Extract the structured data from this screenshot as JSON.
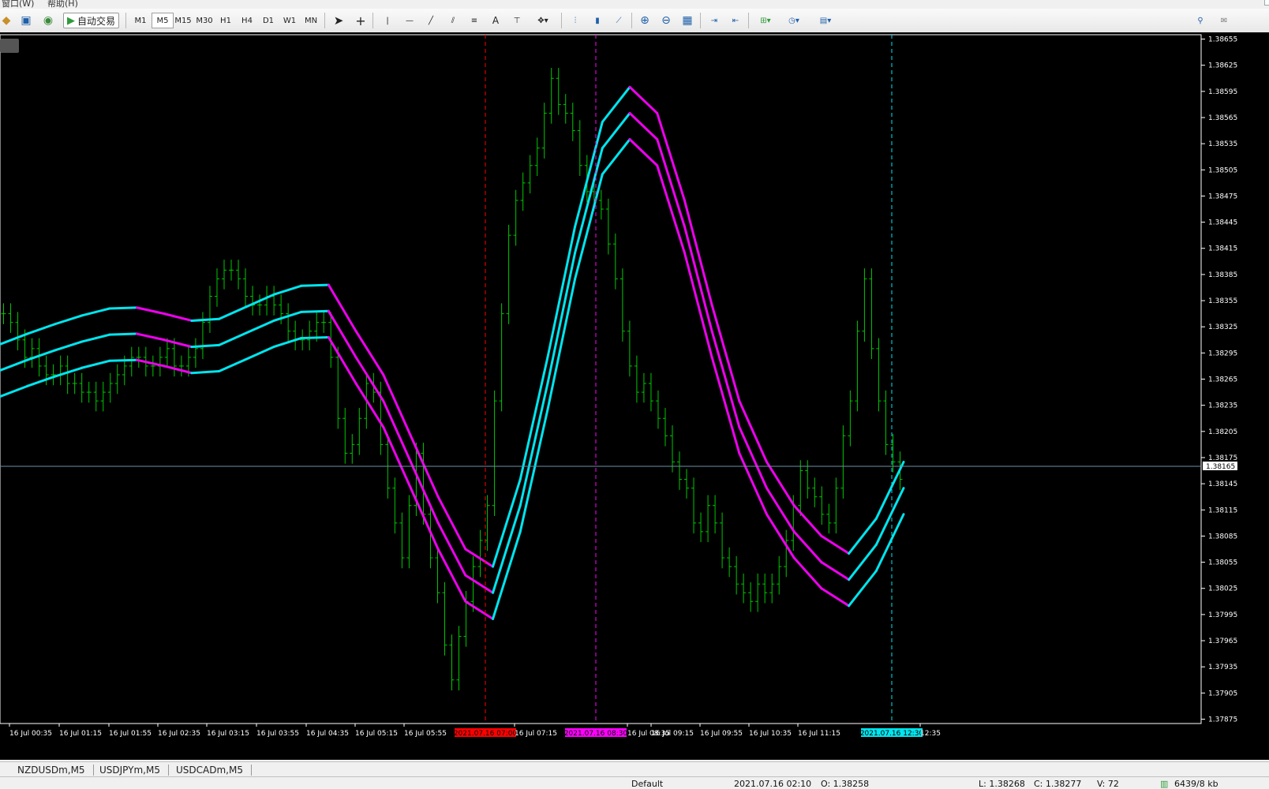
{
  "menu": {
    "window": "窗口(W)",
    "help": "帮助(H)"
  },
  "toolbar": {
    "autotrade_label": "自动交易",
    "timeframes": [
      "M1",
      "M5",
      "M15",
      "M30",
      "H1",
      "H4",
      "D1",
      "W1",
      "MN"
    ],
    "active_timeframe": "M5",
    "text_tool": "A"
  },
  "tabs": [
    "NZDUSDm,M5",
    "USDJPYm,M5",
    "USDCADm,M5"
  ],
  "status": {
    "profile": "Default",
    "datetime": "2021.07.16 02:10",
    "open": "O: 1.38258",
    "low": "L: 1.38268",
    "close": "C: 1.38277",
    "volume": "V: 72",
    "traffic": "6439/8 kb"
  },
  "colors": {
    "background": "#000000",
    "bars": "#00c800",
    "band_up": "#00e5ee",
    "band_down": "#ee00ee",
    "axis": "#ffffff",
    "price_line": "#6f8fa8"
  },
  "chart_data": {
    "type": "line",
    "symbol": "USDCADm,M5",
    "ylim": [
      1.3786,
      1.3868
    ],
    "y_ticks": [
      "1.38655",
      "1.38625",
      "1.38595",
      "1.38565",
      "1.38535",
      "1.38505",
      "1.38475",
      "1.38445",
      "1.38415",
      "1.38385",
      "1.38355",
      "1.38325",
      "1.38295",
      "1.38265",
      "1.38235",
      "1.38205",
      "1.38175",
      "1.38145",
      "1.38115",
      "1.38085",
      "1.38055",
      "1.38025",
      "1.37995",
      "1.37965",
      "1.37935",
      "1.37905",
      "1.37875"
    ],
    "x_labels": [
      "16 Jul 00:35",
      "16 Jul 01:15",
      "16 Jul 01:55",
      "16 Jul 02:35",
      "16 Jul 03:15",
      "16 Jul 03:55",
      "16 Jul 04:35",
      "16 Jul 05:15",
      "16 Jul 05:55",
      "16 Jul 07:15",
      "16 Jul 08:35",
      "16 Jul 09:15",
      "16 Jul 09:55",
      "16 Jul 10:35",
      "16 Jul 11:15",
      "12:35"
    ],
    "current_price": "1.38165",
    "vlines": [
      {
        "label": "2021.07.16 07:00",
        "color": "#ff0000"
      },
      {
        "label": "2021.07.16 08:30",
        "color": "#ff00ff"
      },
      {
        "label": "2021.07.16 12:30",
        "color": "#00e5ee"
      }
    ],
    "envelope_mid": [
      1.38275,
      1.38287,
      1.38298,
      1.38308,
      1.38316,
      1.38317,
      1.3831,
      1.38302,
      1.38304,
      1.38318,
      1.38332,
      1.38342,
      1.38343,
      1.3829,
      1.3824,
      1.3817,
      1.381,
      1.3804,
      1.3802,
      1.3812,
      1.3826,
      1.3841,
      1.3853,
      1.3857,
      1.3854,
      1.3844,
      1.3832,
      1.3821,
      1.3814,
      1.3809,
      1.38055,
      1.38035,
      1.38075,
      1.3814
    ],
    "band_offset": 0.0003,
    "bars": [
      1.3834,
      1.3833,
      1.3831,
      1.3829,
      1.383,
      1.3828,
      1.3827,
      1.3827,
      1.3828,
      1.3826,
      1.3826,
      1.3825,
      1.3825,
      1.3824,
      1.3825,
      1.3826,
      1.3827,
      1.3828,
      1.3829,
      1.3829,
      1.3828,
      1.3828,
      1.3829,
      1.383,
      1.3828,
      1.3828,
      1.3829,
      1.383,
      1.3833,
      1.3836,
      1.3838,
      1.3839,
      1.3839,
      1.3838,
      1.3836,
      1.3835,
      1.3835,
      1.3836,
      1.3835,
      1.3834,
      1.3832,
      1.3831,
      1.3831,
      1.3832,
      1.3833,
      1.3833,
      1.3829,
      1.3822,
      1.3818,
      1.3819,
      1.3822,
      1.3826,
      1.3825,
      1.3819,
      1.3814,
      1.381,
      1.3806,
      1.3812,
      1.3818,
      1.3811,
      1.3806,
      1.3802,
      1.3796,
      1.3792,
      1.3797,
      1.3801,
      1.3805,
      1.3808,
      1.3812,
      1.3824,
      1.3834,
      1.3843,
      1.3847,
      1.3849,
      1.3851,
      1.3853,
      1.3857,
      1.3861,
      1.3858,
      1.3857,
      1.3855,
      1.3851,
      1.3848,
      1.3847,
      1.3846,
      1.3842,
      1.3838,
      1.3832,
      1.3828,
      1.3825,
      1.3826,
      1.3824,
      1.3822,
      1.382,
      1.3817,
      1.3815,
      1.3814,
      1.381,
      1.3809,
      1.3812,
      1.381,
      1.3806,
      1.3805,
      1.3803,
      1.3802,
      1.3801,
      1.3803,
      1.3802,
      1.3803,
      1.3805,
      1.3808,
      1.3812,
      1.3816,
      1.3814,
      1.3813,
      1.3811,
      1.381,
      1.3814,
      1.382,
      1.3824,
      1.3832,
      1.3838,
      1.383,
      1.3824,
      1.3819,
      1.3817,
      1.3815
    ]
  }
}
